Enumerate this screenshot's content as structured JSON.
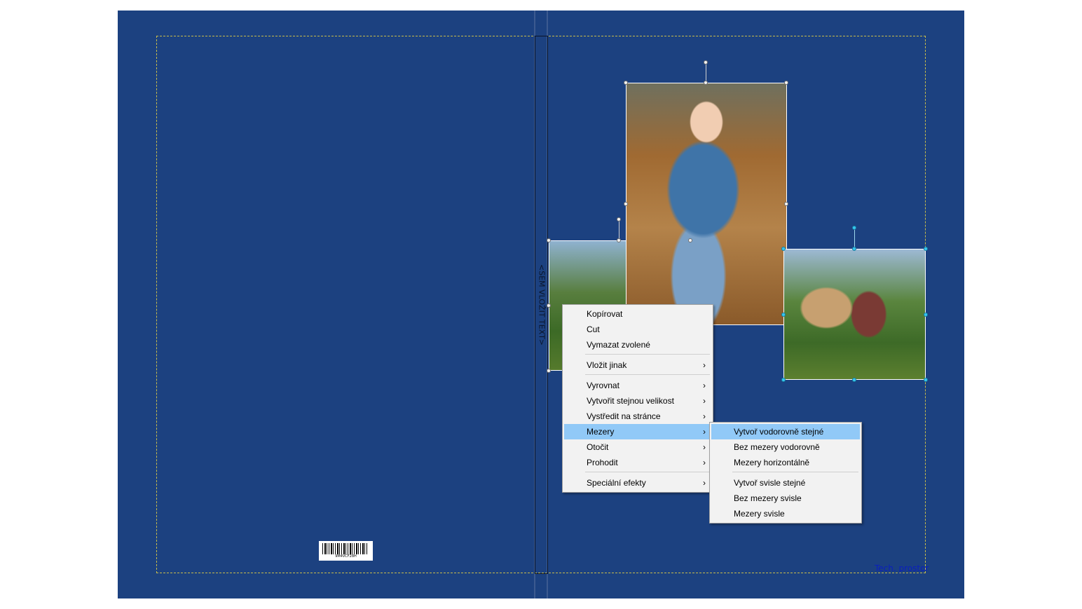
{
  "cover": {
    "background": "#1c4180",
    "spine_text": "<SEM VLOŽIT TEXT>",
    "barcode_number": "9M4VCF28H",
    "tech_label": "Tech. prostor"
  },
  "context_menu": {
    "items": [
      {
        "label": "Kopírovat"
      },
      {
        "label": "Cut"
      },
      {
        "label": "Vymazat zvolené"
      },
      {
        "label": "Vložit jinak",
        "arrow": "›"
      },
      {
        "label": "Vyrovnat",
        "arrow": "›"
      },
      {
        "label": "Vytvořit stejnou velikost",
        "arrow": "›"
      },
      {
        "label": "Vystředit na stránce",
        "arrow": "›"
      },
      {
        "label": "Mezery",
        "arrow": "›"
      },
      {
        "label": "Otočit",
        "arrow": "›"
      },
      {
        "label": "Prohodit",
        "arrow": "›"
      },
      {
        "label": "Speciální efekty",
        "arrow": "›"
      }
    ]
  },
  "submenu": {
    "items": [
      {
        "label": "Vytvoř vodorovně stejné"
      },
      {
        "label": "Bez mezery vodorovně"
      },
      {
        "label": "Mezery horizontálně"
      },
      {
        "label": "Vytvoř svisle stejné"
      },
      {
        "label": "Bez mezery svisle"
      },
      {
        "label": "Mezery svisle"
      }
    ]
  },
  "colors": {
    "cover_background": "#1c4180",
    "menu_highlight": "#91c9f7",
    "selection_handle_active": "#35c6ef"
  }
}
